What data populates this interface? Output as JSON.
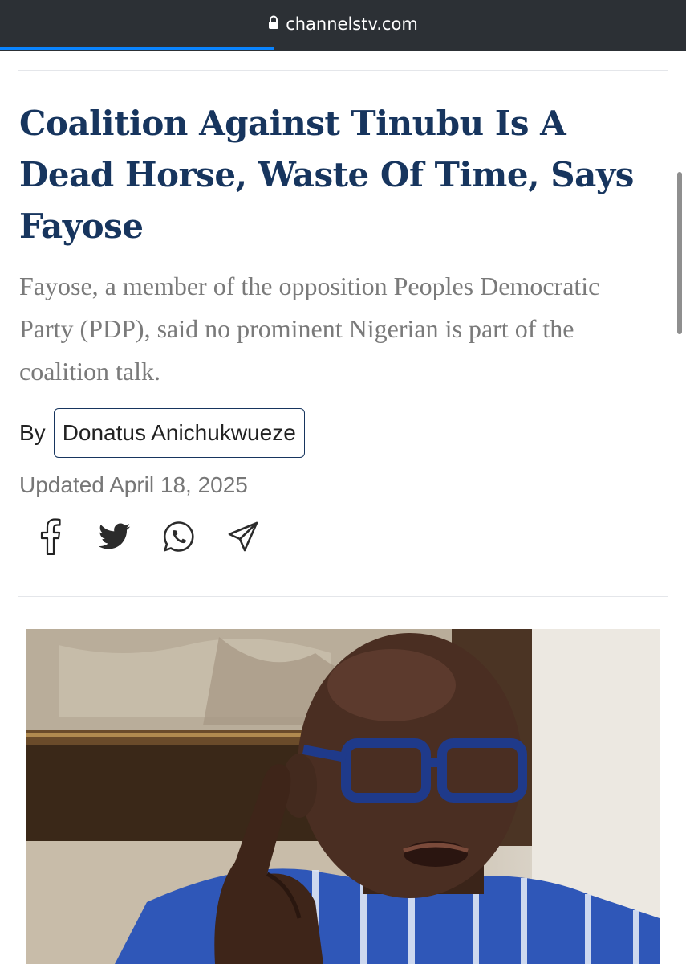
{
  "browser": {
    "url": "channelstv.com",
    "lock_icon": "lock-icon"
  },
  "article": {
    "headline": "Coalition Against Tinubu Is A Dead Horse, Waste Of Time, Says Fayose",
    "summary": "Fayose, a member of the opposition Peoples Democratic Party (PDP), said no prominent Nigerian is part of the coalition talk.",
    "by_label": "By",
    "author": "Donatus Anichukwueze",
    "updated": "Updated April 18, 2025"
  },
  "share": {
    "icons": [
      "facebook-icon",
      "twitter-icon",
      "whatsapp-icon",
      "telegram-icon"
    ]
  },
  "colors": {
    "headline": "#17355e",
    "toolbar": "#2c3035",
    "load_progress": "#0a84ff"
  }
}
